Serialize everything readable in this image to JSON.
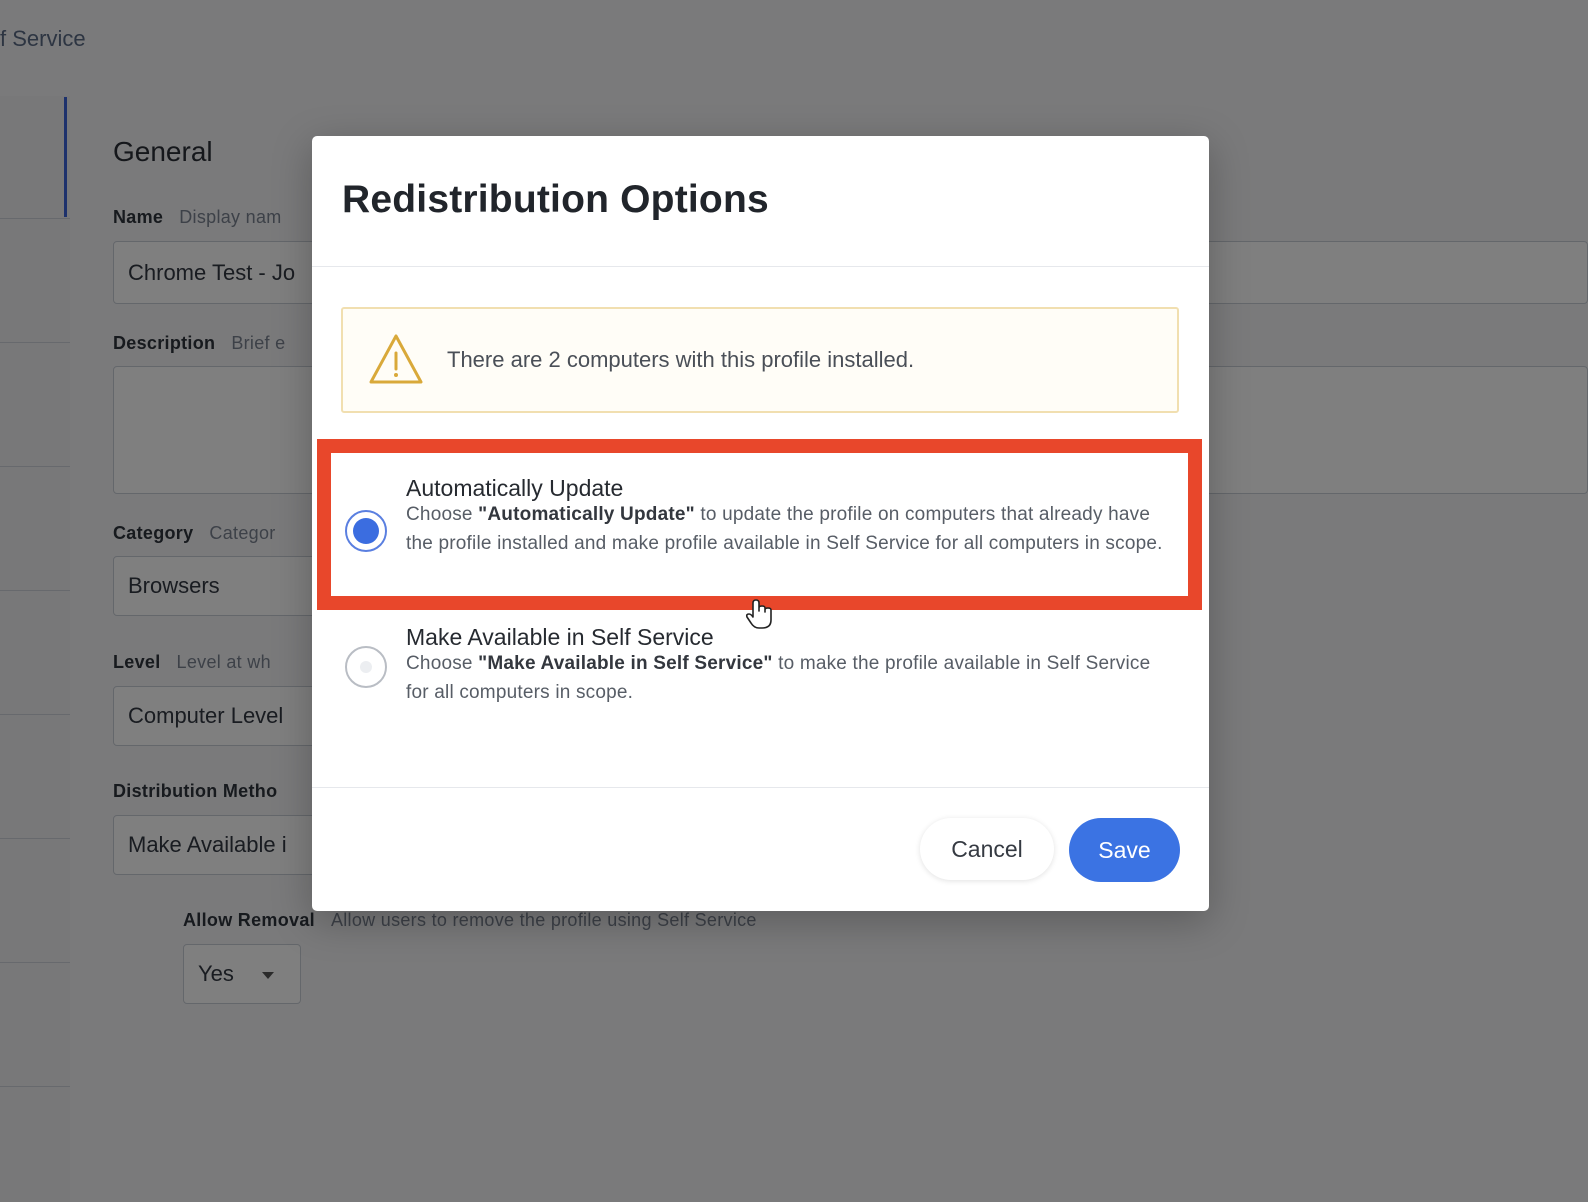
{
  "background": {
    "breadcrumb": "f Service",
    "section_title": "General",
    "fields": {
      "name": {
        "label": "Name",
        "hint": "Display nam",
        "value": "Chrome Test - Jo"
      },
      "description": {
        "label": "Description",
        "hint": "Brief e",
        "value": ""
      },
      "category": {
        "label": "Category",
        "hint": "Categor",
        "value": "Browsers"
      },
      "level": {
        "label": "Level",
        "hint": "Level at wh",
        "value": "Computer Level"
      },
      "distribution": {
        "label": "Distribution Metho",
        "value": "Make Available i"
      },
      "allow_removal": {
        "label": "Allow Removal",
        "hint": "Allow users to remove the profile using Self Service",
        "value": "Yes"
      }
    }
  },
  "modal": {
    "title": "Redistribution Options",
    "warning": {
      "icon": "warning-triangle-icon",
      "text": "There are 2 computers with this profile installed."
    },
    "options": [
      {
        "title": "Automatically Update",
        "selected": true,
        "desc_prefix": "Choose ",
        "desc_bold": "\"Automatically Update\"",
        "desc_suffix": " to update the profile on computers that already have the profile installed and make profile available in Self Service for all computers in scope."
      },
      {
        "title": "Make Available in Self Service",
        "selected": false,
        "desc_prefix": "Choose ",
        "desc_bold": "\"Make Available in Self Service\"",
        "desc_suffix": " to make the profile available in Self Service for all computers in scope."
      }
    ],
    "buttons": {
      "cancel": "Cancel",
      "save": "Save"
    }
  },
  "colors": {
    "highlight": "#e8472b",
    "accent": "#3b73e3",
    "warning_border": "#f1dfb0"
  }
}
